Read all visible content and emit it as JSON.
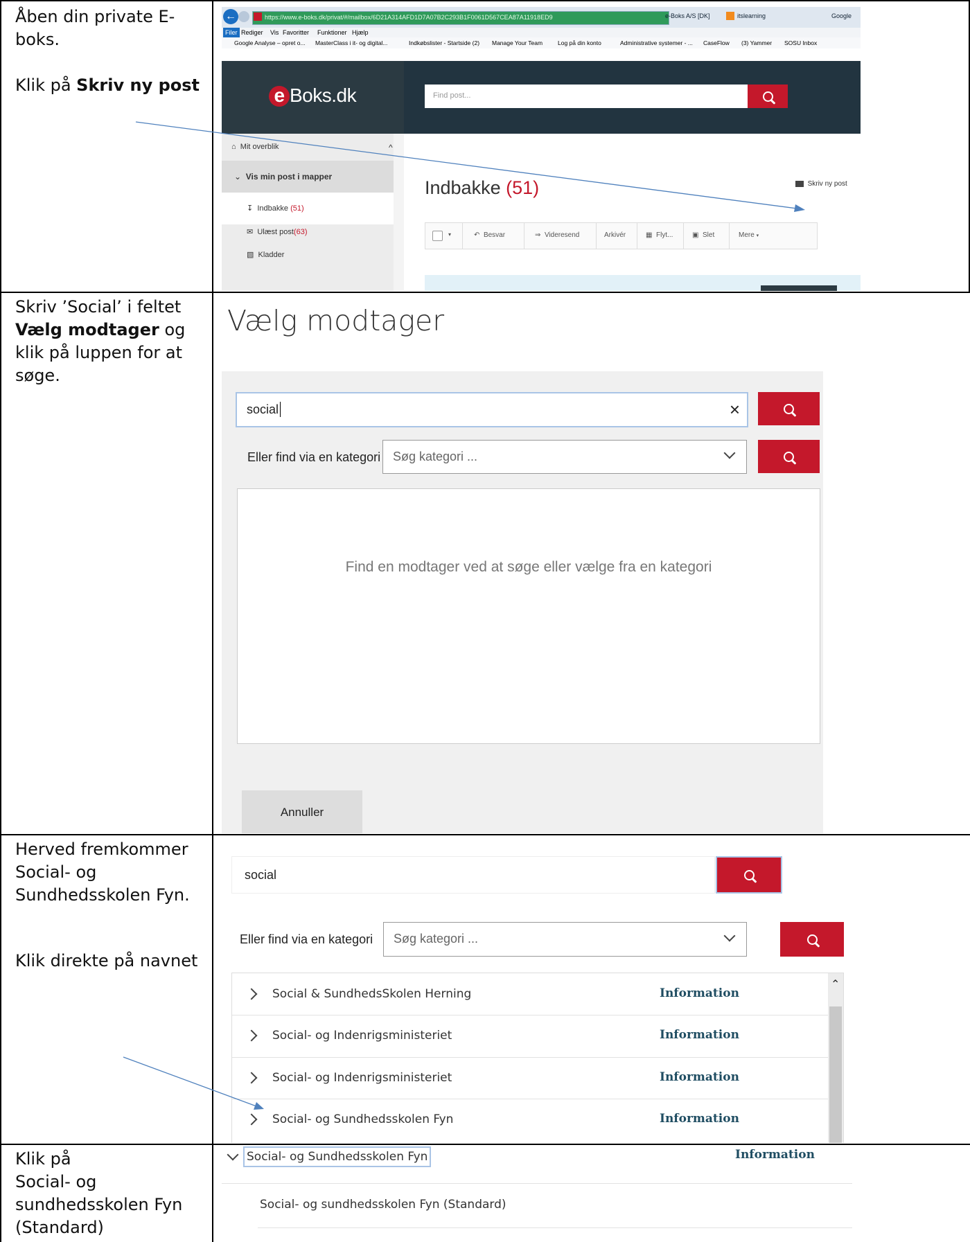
{
  "instructions": {
    "row1": {
      "line1": "Åben din private E-",
      "line2": "boks.",
      "line3_prefix": "Klik på ",
      "line3_bold": "Skriv ny post"
    },
    "row2": {
      "line1": "Skriv ’Social’ i feltet",
      "line2_bold": "Vælg modtager",
      "line2_suffix": " og",
      "line3": "klik på luppen for at",
      "line4": "søge."
    },
    "row3": {
      "line1": "Herved fremkommer",
      "line2": "Social- og",
      "line3": "Sundhedsskolen Fyn.",
      "line4": "Klik direkte på navnet"
    },
    "row4": {
      "line1": "Klik på",
      "line2": "Social- og",
      "line3": "sundhedsskolen Fyn",
      "line4": "(Standard)"
    }
  },
  "browser": {
    "url": "https://www.e-boks.dk/privat/#/mailbox/6D21A314AFD1D7A07B2C293B1F0061D567CEA87A11918ED9",
    "tab_site": "e-Boks A/S [DK]",
    "tab2": "itslearning",
    "tab3": "Google",
    "menu": [
      "Filer",
      "Rediger",
      "Vis",
      "Favoritter",
      "Funktioner",
      "Hjælp"
    ],
    "favorites": [
      "Google Analyse – opret o...",
      "MasterClass i it- og digital...",
      "Indkøbslister - Startside (2)",
      "Manage Your Team",
      "Log på din konto",
      "Administrative systemer - ...",
      "CaseFlow",
      "(3) Yammer",
      "SOSU Inbox"
    ]
  },
  "eboks": {
    "logo_e": "e",
    "logo_text": "Boks.dk",
    "search_placeholder": "Find post...",
    "sidebar": {
      "overview": "Mit overblik",
      "folders": "Vis min post i mapper",
      "inbox": "Indbakke",
      "inbox_count": "(51)",
      "unread": "Ulæst post",
      "unread_count": "(63)",
      "drafts": "Kladder"
    },
    "title": "Indbakke",
    "title_count": "(51)",
    "compose": "Skriv ny post",
    "toolbar": [
      "Besvar",
      "Videresend",
      "Arkivér",
      "Flyt...",
      "Slet",
      "Mere"
    ]
  },
  "recipient_dialog": {
    "title": "Vælg modtager",
    "search_value": "social",
    "clear": "×",
    "category_label": "Eller find via en kategori",
    "category_placeholder": "Søg kategori ...",
    "empty_text": "Find en modtager ved at søge eller vælge fra en kategori",
    "cancel": "Annuller"
  },
  "results": {
    "search_value": "social",
    "category_label": "Eller find via en kategori",
    "category_placeholder": "Søg kategori ...",
    "items": [
      {
        "name": "Social & SundhedsSkolen Herning",
        "info": "Information"
      },
      {
        "name": "Social- og Indenrigsministeriet",
        "info": "Information"
      },
      {
        "name": "Social- og Indenrigsministeriet",
        "info": "Information"
      },
      {
        "name": "Social- og Sundhedsskolen Fyn",
        "info": "Information"
      }
    ]
  },
  "expanded": {
    "name": "Social- og Sundhedsskolen Fyn",
    "info": "Information",
    "sub": "Social- og sundhedsskolen Fyn (Standard)"
  }
}
